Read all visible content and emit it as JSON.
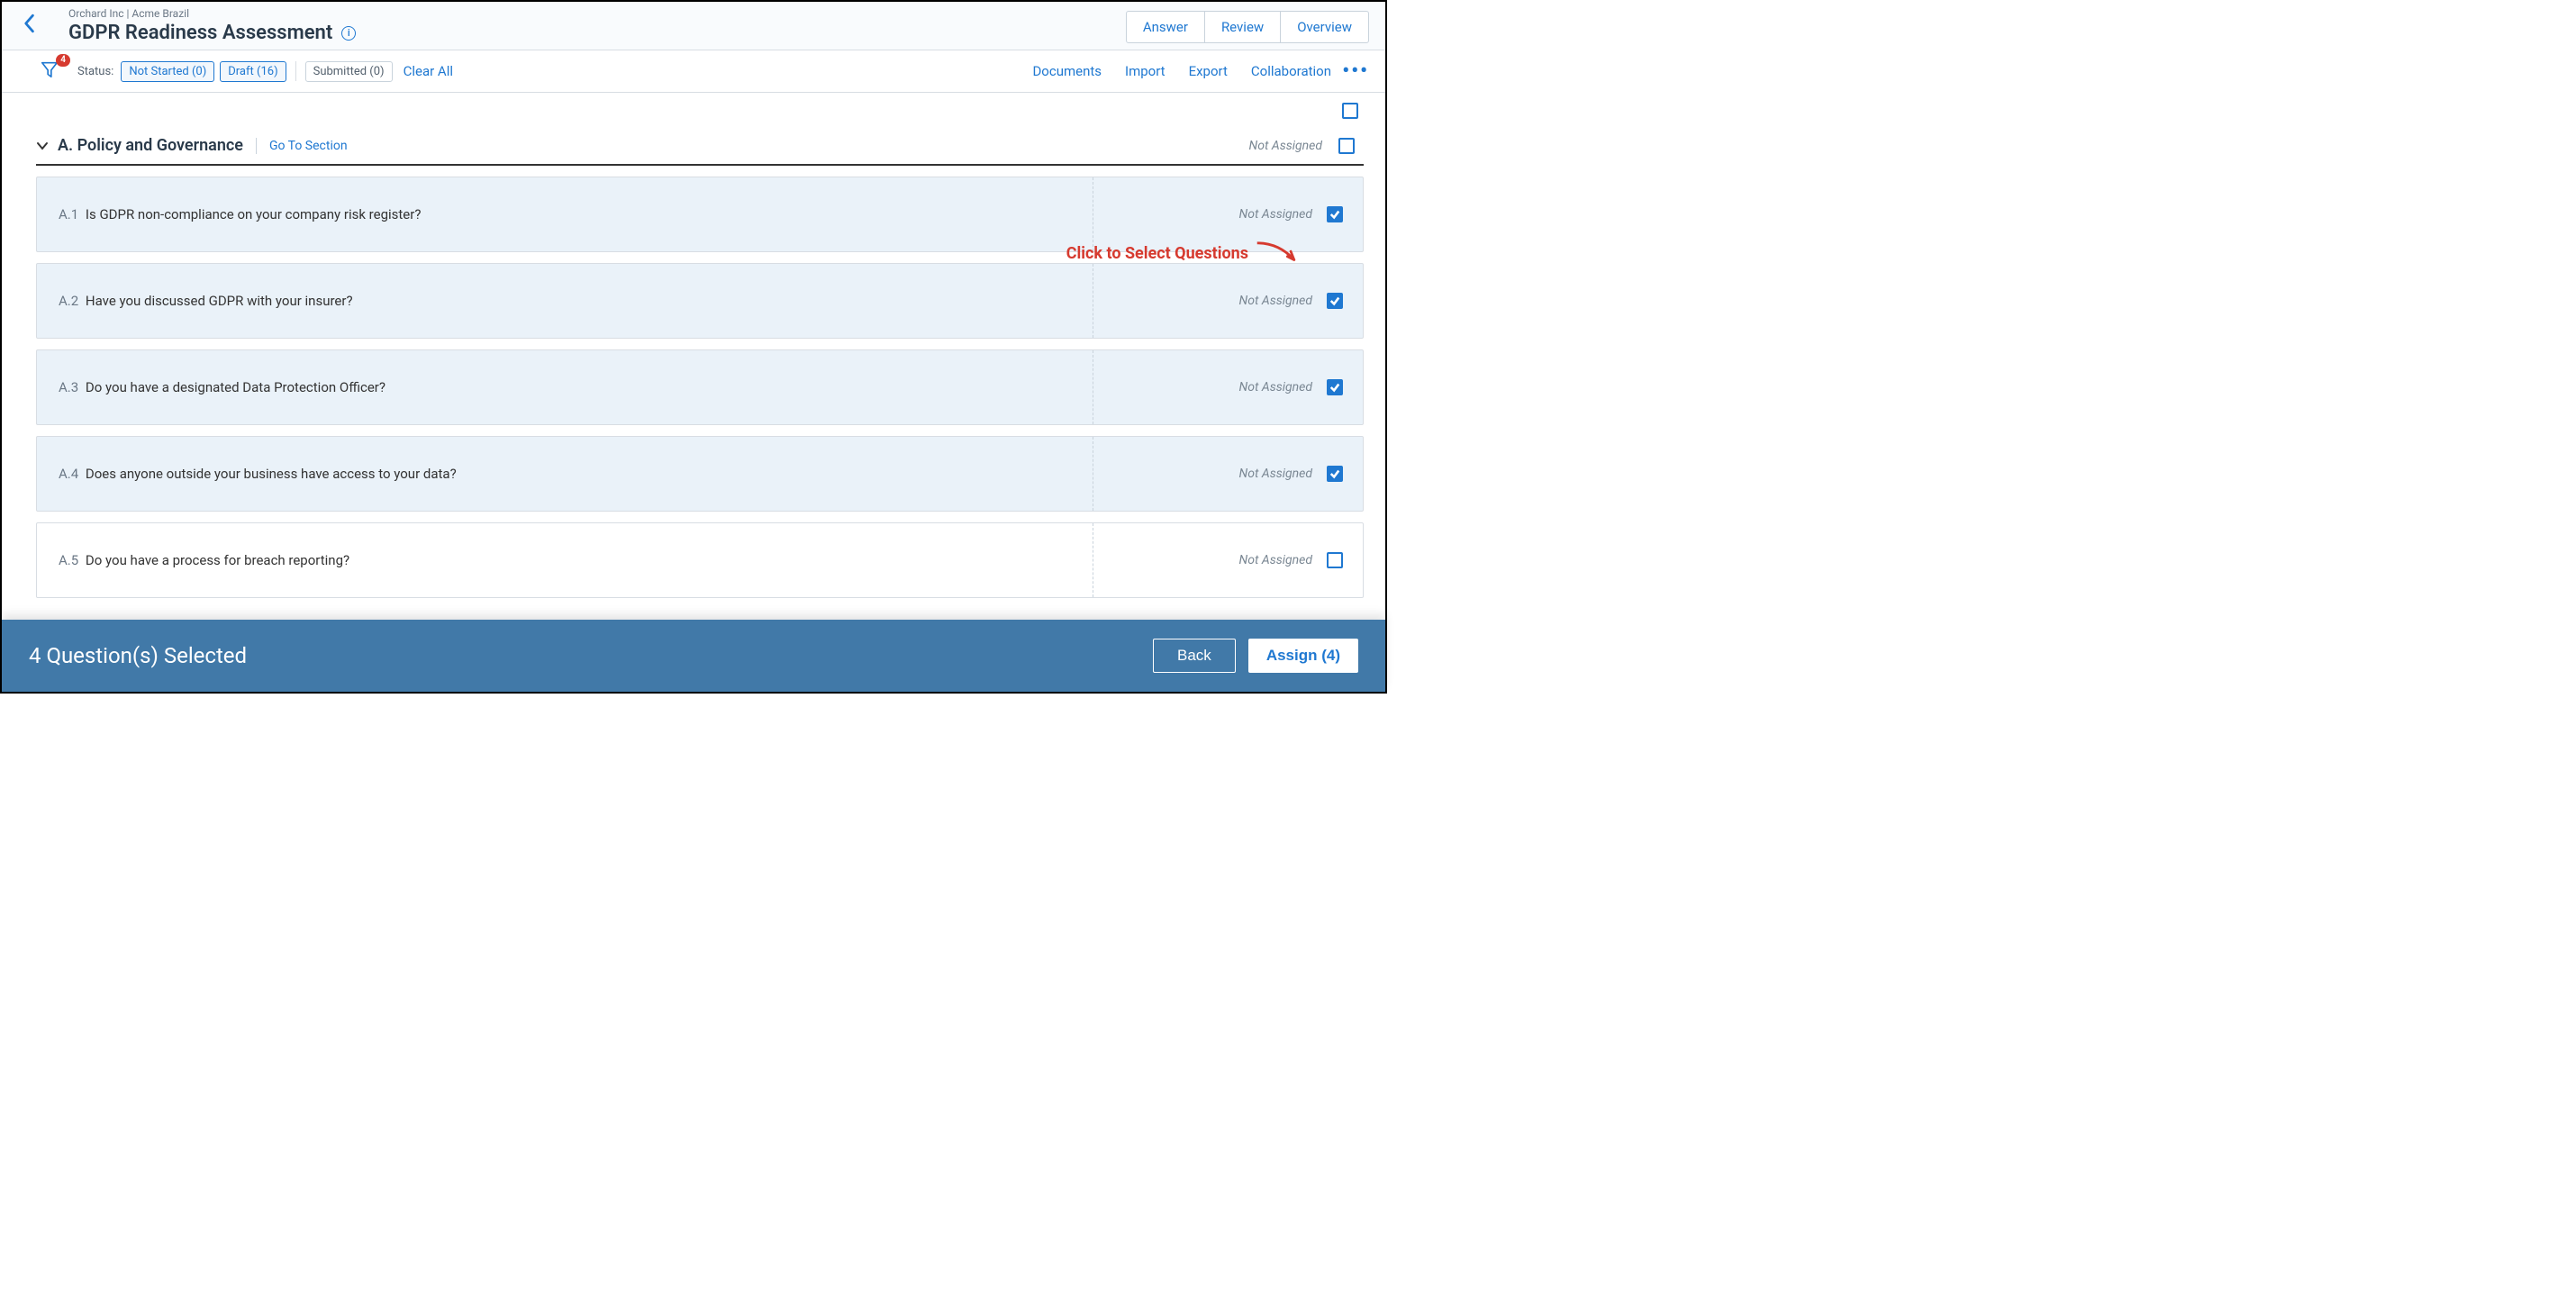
{
  "header": {
    "breadcrumb": "Orchard Inc | Acme Brazil",
    "title": "GDPR Readiness Assessment",
    "tabs": {
      "answer": "Answer",
      "review": "Review",
      "overview": "Overview"
    }
  },
  "filter": {
    "badge": "4",
    "status_label": "Status:",
    "not_started": "Not Started (0)",
    "draft": "Draft (16)",
    "submitted": "Submitted (0)",
    "clear_all": "Clear All",
    "links": {
      "documents": "Documents",
      "import": "Import",
      "export": "Export",
      "collaboration": "Collaboration"
    }
  },
  "annotation": "Click to Select Questions",
  "section": {
    "title": "A. Policy and Governance",
    "goto": "Go To Section",
    "status": "Not Assigned"
  },
  "questions": [
    {
      "num": "A.1",
      "text": "Is GDPR non-compliance on your company risk register?",
      "status": "Not Assigned",
      "checked": true
    },
    {
      "num": "A.2",
      "text": "Have you discussed GDPR with your insurer?",
      "status": "Not Assigned",
      "checked": true
    },
    {
      "num": "A.3",
      "text": "Do you have a designated Data Protection Officer?",
      "status": "Not Assigned",
      "checked": true
    },
    {
      "num": "A.4",
      "text": "Does anyone outside your business have access to your data?",
      "status": "Not Assigned",
      "checked": true
    },
    {
      "num": "A.5",
      "text": "Do you have a process for breach reporting?",
      "status": "Not Assigned",
      "checked": false
    }
  ],
  "footer": {
    "text": "4 Question(s) Selected",
    "back": "Back",
    "assign": "Assign (4)"
  }
}
